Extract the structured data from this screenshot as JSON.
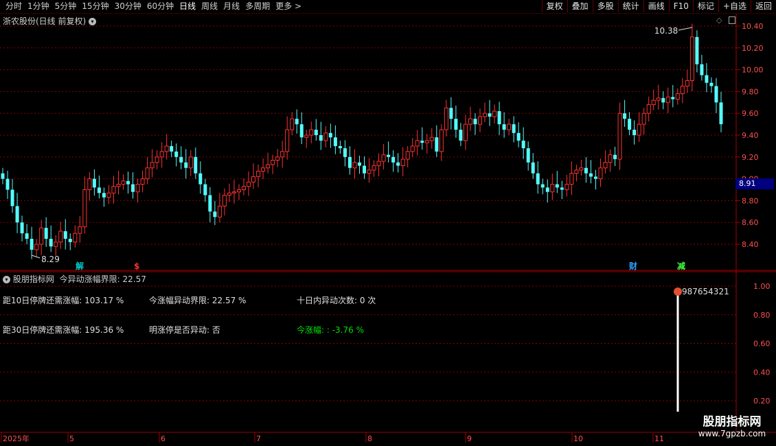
{
  "toolbar": {
    "periods": [
      "分时",
      "1分钟",
      "5分钟",
      "15分钟",
      "30分钟",
      "60分钟",
      "日线",
      "周线",
      "月线",
      "多周期",
      "更多 >"
    ],
    "active_period": "日线",
    "right_buttons": [
      "复权",
      "叠加",
      "多股",
      "统计",
      "画线",
      "F10",
      "标记",
      "+自选",
      "返回"
    ]
  },
  "main_panel": {
    "title": "浙农股份(日线 前复权)",
    "high_label": "10.38",
    "low_label": "8.29",
    "current_price": "8.91",
    "event_markers": [
      {
        "text": "解",
        "color": "#00c8c8"
      },
      {
        "text": "$",
        "color": "#ff3030"
      },
      {
        "text": "财",
        "color": "#2ea0ff"
      },
      {
        "text": "减",
        "color": "#40ff40"
      }
    ]
  },
  "price_axis": [
    "10.40",
    "10.20",
    "10.00",
    "9.80",
    "9.60",
    "9.40",
    "9.20",
    "9.00",
    "8.80",
    "8.60",
    "8.40"
  ],
  "indicator_panel": {
    "title": "股朋指标网",
    "subtitle": "今异动涨幅界限: 22.57",
    "fields": {
      "d10": "距10日停牌还需涨幅: 103.17 %",
      "limit": "今涨幅异动界限: 22.57 %",
      "count10": "十日内异动次数: 0 次",
      "d30": "距30日停牌还需涨幅: 195.36 %",
      "tomorrow": "明涨停是否异动: 否",
      "today": "今涨幅: : -3.76 %"
    },
    "marker_label": "987654321",
    "axis": [
      "1.00",
      "0.80",
      "0.60",
      "0.40",
      "0.20"
    ],
    "bar_value": 1.0
  },
  "date_axis": [
    "2025年",
    "5",
    "6",
    "7",
    "8",
    "9",
    "10",
    "11"
  ],
  "watermark": {
    "line1": "股朋指标网",
    "line2": "www.7gpzb.com"
  },
  "colors": {
    "up": "#ff3232",
    "down": "#54ffff",
    "grid": "#8b0000",
    "accent": "#00e000"
  },
  "chart_data": {
    "type": "candlestick",
    "title": "浙农股份(日线 前复权)",
    "ylim": [
      8.3,
      10.45
    ],
    "close": [
      9.0,
      8.9,
      8.75,
      8.6,
      8.5,
      8.45,
      8.35,
      8.4,
      8.55,
      8.45,
      8.38,
      8.42,
      8.52,
      8.45,
      8.42,
      8.5,
      8.56,
      8.9,
      9.0,
      8.92,
      8.87,
      8.83,
      8.87,
      8.93,
      8.95,
      8.98,
      8.95,
      8.88,
      8.95,
      9.0,
      9.1,
      9.15,
      9.2,
      9.25,
      9.3,
      9.25,
      9.2,
      9.15,
      9.1,
      9.2,
      9.05,
      8.95,
      8.85,
      8.7,
      8.65,
      8.75,
      8.85,
      8.87,
      8.88,
      8.9,
      8.93,
      8.97,
      9.02,
      9.07,
      9.1,
      9.13,
      9.17,
      9.2,
      9.25,
      9.45,
      9.55,
      9.5,
      9.38,
      9.4,
      9.45,
      9.4,
      9.35,
      9.42,
      9.38,
      9.3,
      9.28,
      9.2,
      9.1,
      9.15,
      9.12,
      9.05,
      9.08,
      9.12,
      9.16,
      9.22,
      9.2,
      9.15,
      9.12,
      9.18,
      9.25,
      9.3,
      9.35,
      9.33,
      9.35,
      9.38,
      9.25,
      9.45,
      9.65,
      9.55,
      9.45,
      9.35,
      9.5,
      9.55,
      9.5,
      9.57,
      9.6,
      9.57,
      9.62,
      9.5,
      9.45,
      9.5,
      9.42,
      9.35,
      9.28,
      9.15,
      9.05,
      8.95,
      8.92,
      8.88,
      8.95,
      8.92,
      8.9,
      8.95,
      9.05,
      9.08,
      9.1,
      9.05,
      9.02,
      9.0,
      9.1,
      9.15,
      9.22,
      9.18,
      9.6,
      9.55,
      9.45,
      9.4,
      9.5,
      9.6,
      9.68,
      9.72,
      9.74,
      9.7,
      9.75,
      9.73,
      9.78,
      9.85,
      9.9,
      10.3,
      10.05,
      9.95,
      9.88,
      9.85,
      9.7,
      9.5
    ]
  }
}
